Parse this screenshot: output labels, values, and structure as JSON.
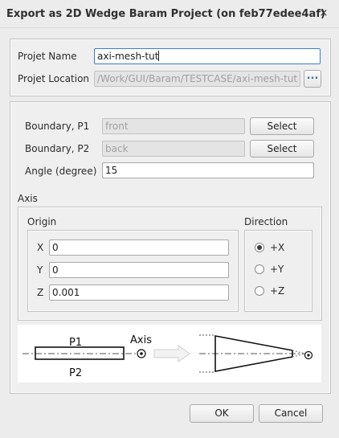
{
  "window": {
    "title": "Export as 2D Wedge Baram Project (on feb77edee4af)",
    "close_glyph": "×"
  },
  "project": {
    "name_label": "Projet Name",
    "name_value": "axi-mesh-tut",
    "location_label": "Projet Location",
    "location_value": "/Work/GUI/Baram/TESTCASE/axi-mesh-tut",
    "browse_label": "..."
  },
  "boundary": {
    "p1_label": "Boundary, P1",
    "p1_value": "front",
    "p2_label": "Boundary, P2",
    "p2_value": "back",
    "select_label": "Select",
    "angle_label": "Angle (degree)",
    "angle_value": "15"
  },
  "axis": {
    "group_label": "Axis",
    "origin_label": "Origin",
    "x_label": "X",
    "x_value": "0",
    "y_label": "Y",
    "y_value": "0",
    "z_label": "Z",
    "z_value": "0.001",
    "direction_label": "Direction",
    "directions": [
      {
        "label": "+X",
        "checked": true
      },
      {
        "label": "+Y",
        "checked": false
      },
      {
        "label": "+Z",
        "checked": false
      }
    ]
  },
  "diagram": {
    "p1_label": "P1",
    "p2_label": "P2",
    "axis_label": "Axis"
  },
  "footer": {
    "ok_label": "OK",
    "cancel_label": "Cancel"
  }
}
